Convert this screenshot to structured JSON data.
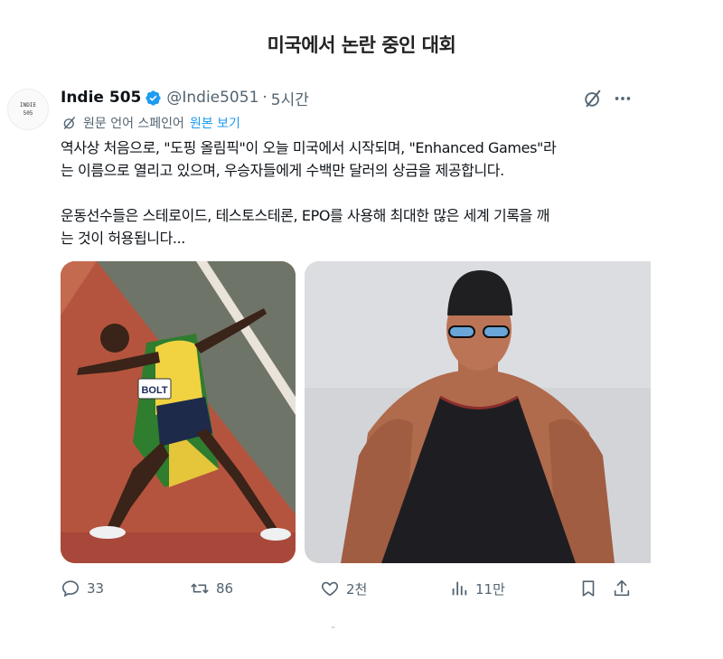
{
  "page": {
    "title": "미국에서 논란 중인 대회"
  },
  "tweet": {
    "avatar_text_line1": "INDIE",
    "avatar_text_line2": "505",
    "display_name": "Indie 505",
    "handle": "@Indie5051",
    "separator": "·",
    "time": "5시간",
    "translation_note": "원문 언어 스페인어",
    "show_original_label": "원본 보기",
    "text_line1": "역사상 처음으로, \"도핑 올림픽\"이 오늘 미국에서 시작되며, \"Enhanced Games\"라",
    "text_line2": "는 이름으로 열리고 있으며, 우승자들에게 수백만 달러의 상금을 제공합니다.",
    "text_line3": "운동선수들은 스테로이드, 테스토스테론, EPO를 사용해 최대한 많은 세계 기록을 깨",
    "text_line4": "는 것이 허용됩니다...",
    "bib_text": "BOLT",
    "stats": {
      "replies": "33",
      "retweets": "86",
      "likes": "2천",
      "views": "11만"
    },
    "icons": {
      "verified": "verified-badge-icon",
      "grok": "grok-icon",
      "more": "more-icon",
      "translate": "translate-icon",
      "reply": "reply-icon",
      "retweet": "retweet-icon",
      "like": "heart-icon",
      "views": "views-icon",
      "bookmark": "bookmark-icon",
      "share": "share-icon"
    },
    "accent_color": "#1d9bf0",
    "muted_color": "#536471"
  },
  "footer": {
    "mark": "¨"
  }
}
